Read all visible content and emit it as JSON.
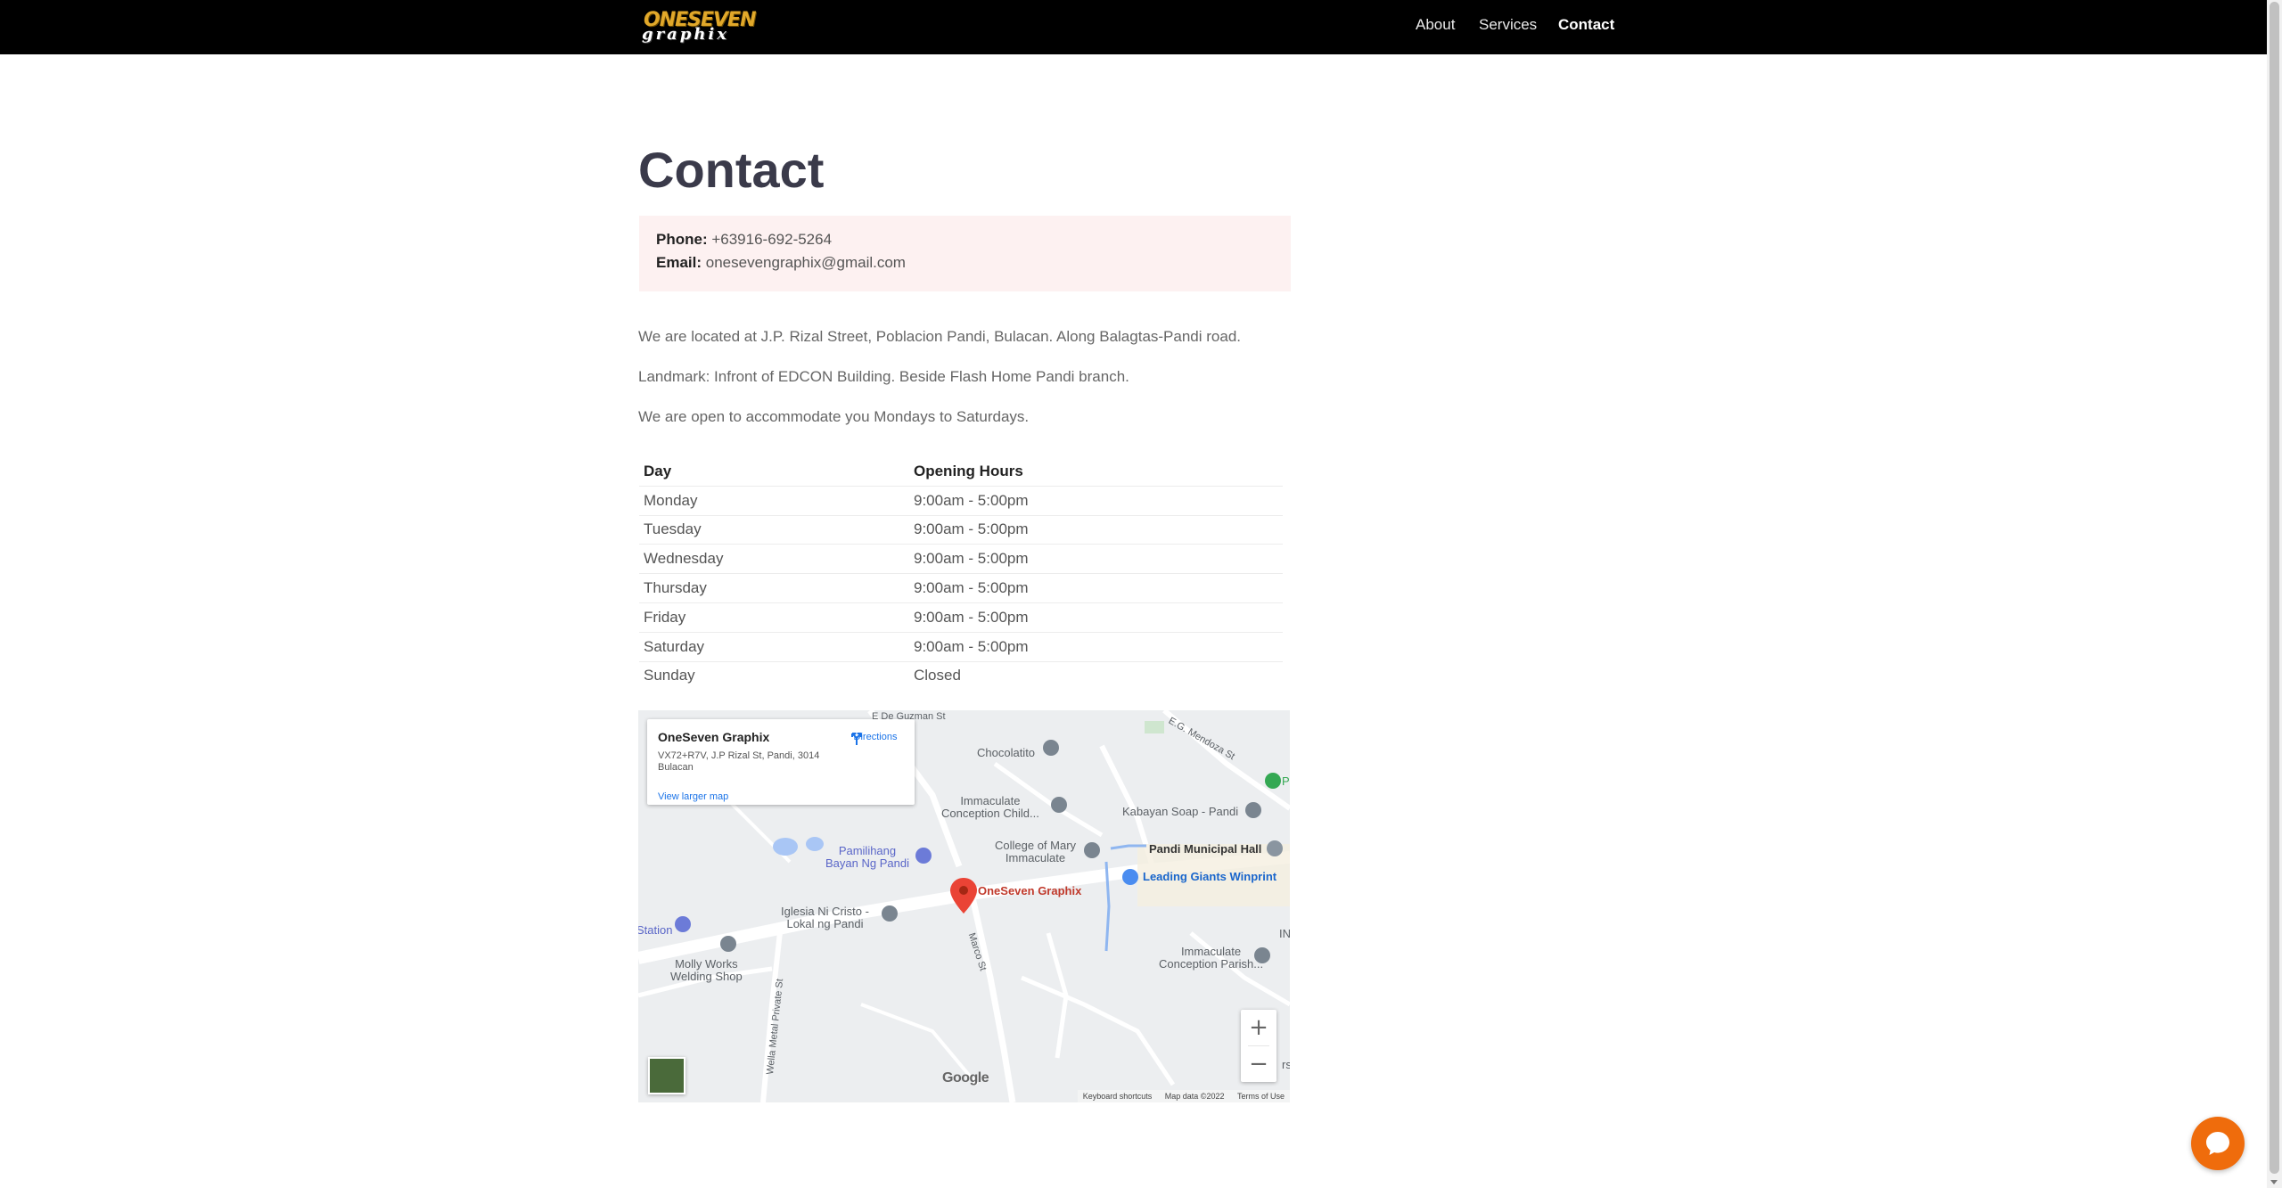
{
  "header": {
    "logo_line1": "ONESEVEN",
    "logo_line2": "graphix",
    "nav": [
      {
        "label": "About",
        "active": false
      },
      {
        "label": "Services",
        "active": false
      },
      {
        "label": "Contact",
        "active": true
      }
    ]
  },
  "page": {
    "title": "Contact",
    "contact": {
      "phone_label": "Phone:",
      "phone": "+63916-692-5264",
      "email_label": "Email:",
      "email": "onesevengraphix@gmail.com"
    },
    "paragraphs": [
      "We are located at J.P. Rizal Street, Poblacion Pandi, Bulacan. Along Balagtas-Pandi road.",
      "Landmark: Infront of EDCON Building. Beside Flash Home Pandi branch.",
      "We are open to accommodate you Mondays to Saturdays."
    ],
    "hours_table": {
      "headers": [
        "Day",
        "Opening Hours"
      ],
      "rows": [
        [
          "Monday",
          "9:00am - 5:00pm"
        ],
        [
          "Tuesday",
          "9:00am - 5:00pm"
        ],
        [
          "Wednesday",
          "9:00am - 5:00pm"
        ],
        [
          "Thursday",
          "9:00am - 5:00pm"
        ],
        [
          "Friday",
          "9:00am - 5:00pm"
        ],
        [
          "Saturday",
          "9:00am - 5:00pm"
        ],
        [
          "Sunday",
          "Closed"
        ]
      ]
    }
  },
  "map": {
    "card": {
      "name": "OneSeven Graphix",
      "address": "VX72+R7V, J.P Rizal St, Pandi, 3014 Bulacan",
      "directions": "Directions",
      "view_larger": "View larger map"
    },
    "labels": {
      "chocolatito": "Chocolatito",
      "immaculate_child_1": "Immaculate",
      "immaculate_child_2": "Conception Child...",
      "kabayan": "Kabayan Soap - Pandi",
      "college_1": "College of Mary",
      "college_2": "Immaculate",
      "municipal": "Pandi Municipal Hall",
      "pamilihang_1": "Pamilihang",
      "pamilihang_2": "Bayan Ng Pandi",
      "leading": "Leading Giants Winprint",
      "oneseven": "OneSeven Graphix",
      "iglesia_1": "Iglesia Ni Cristo -",
      "iglesia_2": "Lokal ng Pandi",
      "station": "Station",
      "molly_1": "Molly Works",
      "molly_2": "Welding Shop",
      "parish_1": "Immaculate",
      "parish_2": "Conception Parish...",
      "st_deguzman": "E De Guzman St",
      "st_mendoza": "E.G. Mendoza St",
      "st_marco": "Marco St",
      "st_wella": "Wella Metal Private St",
      "p_edge": "P",
      "in_edge": "IN",
      "rs_edge": "rs"
    },
    "google": "Google",
    "footer": [
      "Keyboard shortcuts",
      "Map data ©2022",
      "Terms of Use"
    ],
    "zoom_in": "+",
    "zoom_out": "−"
  },
  "colors": {
    "header_bg": "#000000",
    "info_bg": "#fdf1f1",
    "chat_button": "#ef6c0c",
    "marker_red": "#ea4335"
  },
  "icons": [
    "directions-icon",
    "map-pin-icon",
    "chat-icon",
    "satellite-thumbnail"
  ]
}
